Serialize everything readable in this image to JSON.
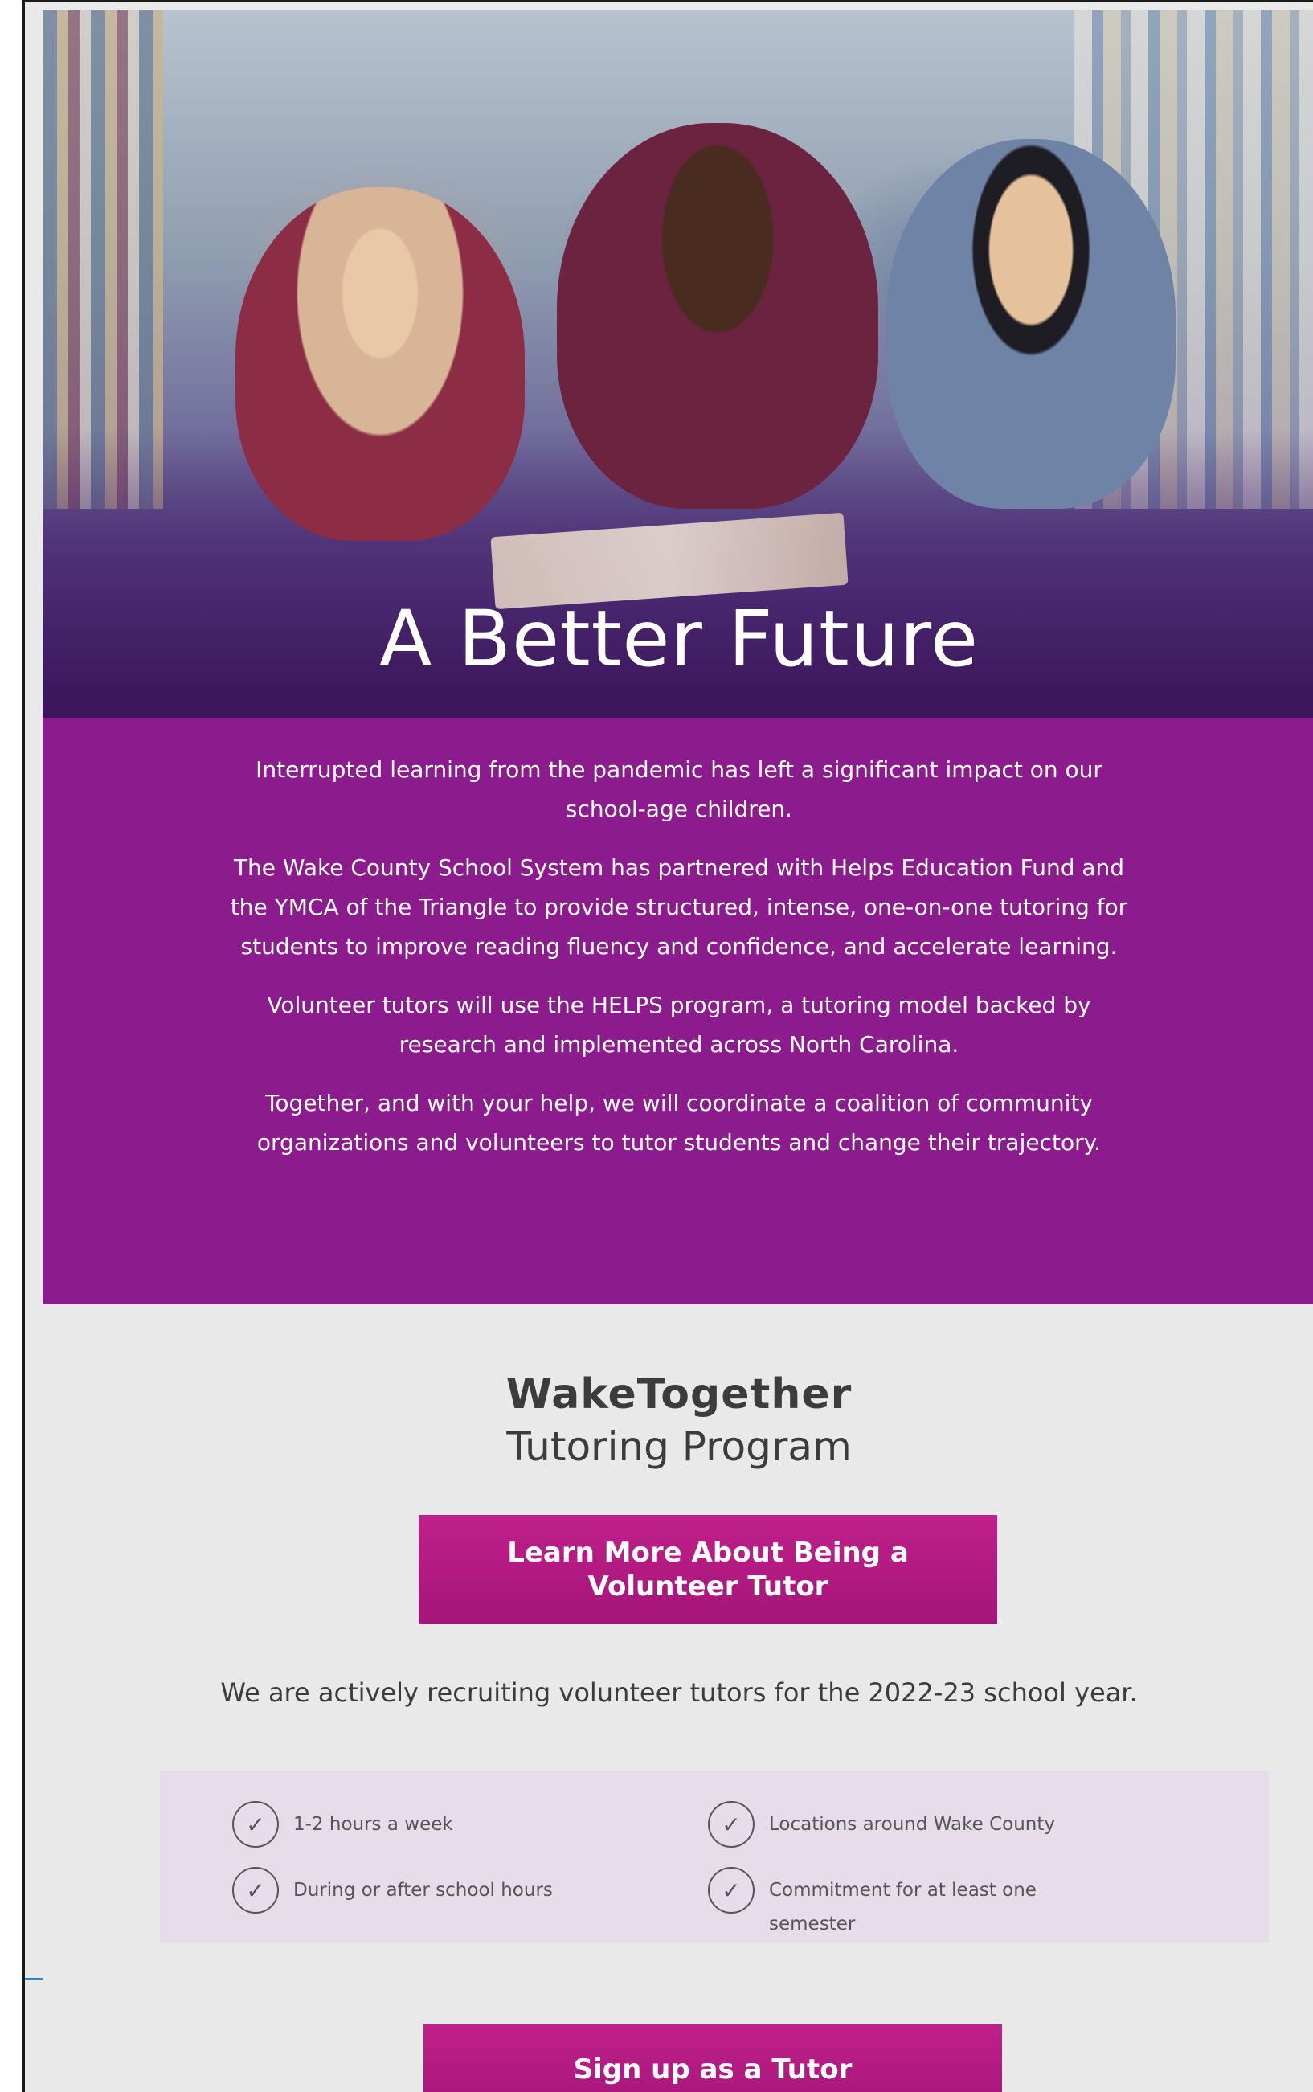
{
  "hero": {
    "title": "A Better Future",
    "image_alt": "Three children lying on a library floor reading a book together"
  },
  "intro": {
    "paragraphs": [
      "Interrupted learning from the pandemic has left a significant impact on our school-age children.",
      "The Wake County School System has partnered with Helps Education Fund and the YMCA of the Triangle to provide structured, intense, one-on-one tutoring for students to improve reading fluency and confidence, and accelerate learning.",
      "Volunteer tutors will use the HELPS program, a tutoring model backed by research and implemented across North Carolina.",
      "Together, and with your help, we will coordinate a coalition of community organizations and volunteers to tutor students and change their trajectory."
    ]
  },
  "program": {
    "name": "WakeTogether",
    "subtitle": "Tutoring Program",
    "learn_more_label": "Learn More About Being a Volunteer Tutor",
    "recruiting_text": "We are actively recruiting volunteer tutors for the 2022-23 school year.",
    "perks": [
      "1-2 hours a week",
      "During or after school hours",
      "Locations around Wake County",
      "Commitment for at least one semester"
    ],
    "signup_label": "Sign up as a Tutor"
  },
  "colors": {
    "purple_band": "#8c1b8d",
    "button": "#b01a84",
    "background": "#e9e9e9",
    "perks_box": "#e6dcea",
    "accent_line": "#2e86c1"
  }
}
